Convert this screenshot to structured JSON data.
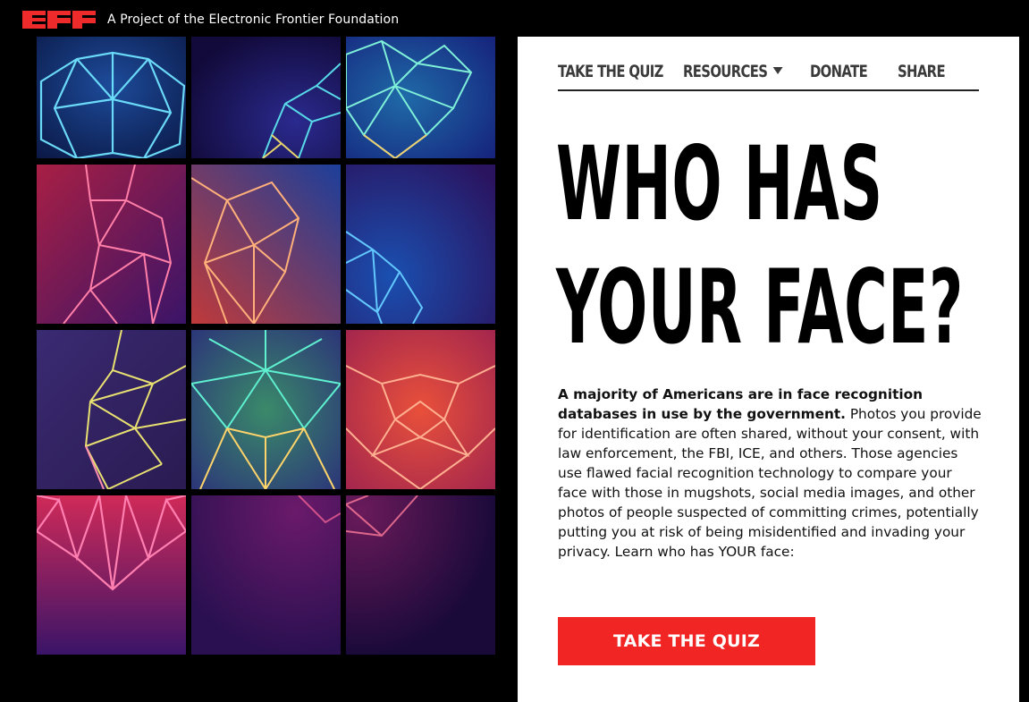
{
  "header": {
    "logo_text": "EFF",
    "tagline": "A Project of the Electronic Frontier Foundation"
  },
  "nav": {
    "items": [
      {
        "label": "TAKE THE QUIZ"
      },
      {
        "label": "RESOURCES"
      },
      {
        "label": "DONATE"
      },
      {
        "label": "SHARE"
      }
    ]
  },
  "hero": {
    "headline_line1": "WHO HAS",
    "headline_line2": "YOUR FACE?",
    "body_bold": "A majority of Americans are in face recognition databases in use by the government.",
    "body_rest": " Photos you provide for identification are often shared, without your consent, with law enforcement, the FBI, ICE, and others. Those agencies use flawed facial recognition technology to compare your face with those in mugshots, social media images, and other photos of people suspected of committing crimes, potentially putting you at risk of being misidentified and invading your privacy. Learn who has YOUR face:",
    "cta_label": "TAKE THE QUIZ"
  },
  "colors": {
    "brand_red": "#ee2a2a",
    "cta_red": "#f22525",
    "background": "#000000",
    "panel": "#ffffff"
  },
  "icons": {
    "resources_dropdown": "caret-down-icon"
  }
}
